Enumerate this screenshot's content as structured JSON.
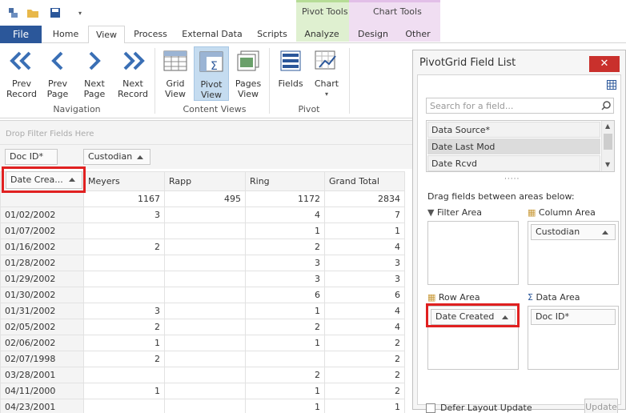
{
  "context_tabs": {
    "pivot_tools": "Pivot Tools",
    "chart_tools": "Chart Tools"
  },
  "tabs": {
    "file": "File",
    "home": "Home",
    "view": "View",
    "process": "Process",
    "external_data": "External Data",
    "scripts": "Scripts",
    "analyze": "Analyze",
    "design": "Design",
    "other": "Other"
  },
  "ribbon": {
    "prev_record": "Prev\nRecord",
    "prev_page": "Prev\nPage",
    "next_page": "Next\nPage",
    "next_record": "Next\nRecord",
    "navigation_label": "Navigation",
    "grid_view": "Grid\nView",
    "pivot_view": "Pivot\nView",
    "pages_view": "Pages\nView",
    "content_views_label": "Content Views",
    "fields": "Fields",
    "chart": "Chart",
    "pivot_label": "Pivot"
  },
  "pivot": {
    "drop_filter": "Drop Filter Fields Here",
    "data_field": "Doc ID*",
    "column_field": "Custodian",
    "row_field": "Date Crea...",
    "columns": [
      "Meyers",
      "Rapp",
      "Ring",
      "Grand Total"
    ],
    "totals": [
      "1167",
      "495",
      "1172",
      "2834"
    ],
    "rows": [
      {
        "date": "01/02/2002",
        "vals": [
          "3",
          "",
          "4",
          "7"
        ]
      },
      {
        "date": "01/07/2002",
        "vals": [
          "",
          "",
          "1",
          "1"
        ]
      },
      {
        "date": "01/16/2002",
        "vals": [
          "2",
          "",
          "2",
          "4"
        ]
      },
      {
        "date": "01/28/2002",
        "vals": [
          "",
          "",
          "3",
          "3"
        ]
      },
      {
        "date": "01/29/2002",
        "vals": [
          "",
          "",
          "3",
          "3"
        ]
      },
      {
        "date": "01/30/2002",
        "vals": [
          "",
          "",
          "6",
          "6"
        ]
      },
      {
        "date": "01/31/2002",
        "vals": [
          "3",
          "",
          "1",
          "4"
        ]
      },
      {
        "date": "02/05/2002",
        "vals": [
          "2",
          "",
          "2",
          "4"
        ]
      },
      {
        "date": "02/06/2002",
        "vals": [
          "1",
          "",
          "1",
          "2"
        ]
      },
      {
        "date": "02/07/1998",
        "vals": [
          "2",
          "",
          "",
          "2"
        ]
      },
      {
        "date": "03/28/2001",
        "vals": [
          "",
          "",
          "2",
          "2"
        ]
      },
      {
        "date": "04/11/2000",
        "vals": [
          "1",
          "",
          "1",
          "2"
        ]
      },
      {
        "date": "04/23/2001",
        "vals": [
          "",
          "",
          "1",
          "1"
        ]
      }
    ]
  },
  "field_list": {
    "title": "PivotGrid Field List",
    "close": "✕",
    "search_placeholder": "Search for a field...",
    "fields": [
      "Data Source*",
      "Date Last Mod",
      "Date Rcvd"
    ],
    "drag_hint": "Drag fields between areas below:",
    "filter_area": "Filter Area",
    "column_area": "Column Area",
    "row_area": "Row Area",
    "data_area": "Data Area",
    "column_field": "Custodian",
    "row_field": "Date Created",
    "data_field": "Doc ID*",
    "defer_label": "Defer Layout Update",
    "update": "Update"
  },
  "colors": {
    "file_tab": "#2b579a",
    "highlight": "#e02020",
    "close": "#c9302c"
  }
}
